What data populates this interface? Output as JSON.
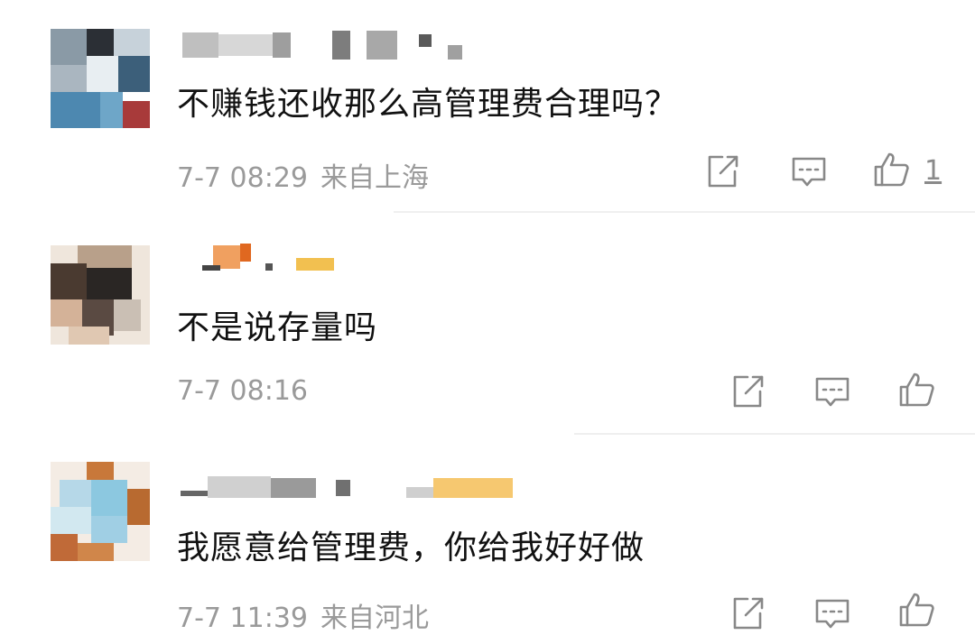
{
  "comments": [
    {
      "text": "不赚钱还收那么高管理费合理吗？",
      "date": "7-7 08:29",
      "location": "来自上海",
      "likes": "1"
    },
    {
      "text": "不是说存量吗",
      "date": "7-7 08:16",
      "location": "",
      "likes": ""
    },
    {
      "text": "我愿意给管理费，你给我好好做",
      "date": "7-7 11:39",
      "location": "来自河北",
      "likes": ""
    }
  ],
  "icons": {
    "repost": "repost-icon",
    "comment": "comment-icon",
    "like": "thumbs-up-icon"
  },
  "colors": {
    "meta_text": "#9a9a9a",
    "icon_stroke": "#888888",
    "divider": "#efefef"
  }
}
